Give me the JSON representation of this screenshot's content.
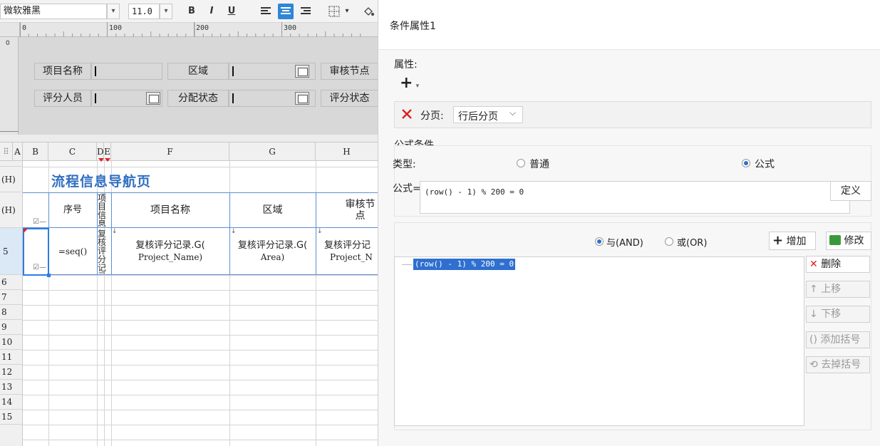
{
  "toolbar": {
    "font_name": "微软雅黑",
    "font_size": "11.0",
    "bold": "B",
    "italic": "I",
    "underline": "U"
  },
  "ruler": {
    "marks": [
      "0",
      "100",
      "200",
      "300"
    ]
  },
  "params": {
    "row1": [
      {
        "label": "项目名称"
      },
      {
        "label": "区域"
      },
      {
        "label": "审核节点"
      }
    ],
    "row2": [
      {
        "label": "评分人员"
      },
      {
        "label": "分配状态"
      },
      {
        "label": "评分状态"
      }
    ]
  },
  "grid": {
    "columns": [
      "A",
      "B",
      "C",
      "D",
      "E",
      "F",
      "G",
      "H"
    ],
    "rows": [
      "(H)",
      "(H)",
      "5",
      "6",
      "7",
      "8",
      "9",
      "10",
      "11",
      "12",
      "13",
      "14",
      "15"
    ],
    "title": "流程信息导航页",
    "headers": {
      "seq": "序号",
      "narrow1": "项目信息",
      "project_name": "项目名称",
      "area": "区域",
      "audit": "审核节点"
    },
    "data": {
      "seq": "=seq()",
      "narrow": "复核评分记录",
      "project_name_l1": "复核评分记录.G(",
      "project_name_l2": "Project_Name)",
      "area_l1": "复核评分记录.G(",
      "area_l2": "Area)",
      "audit_l1": "复核评分记",
      "audit_l2": "Project_N"
    }
  },
  "dialog": {
    "title": "条件属性1",
    "attr_section": "属性:",
    "add_symbol": "+",
    "page_label": "分页:",
    "page_value": "行后分页",
    "formula_section": "公式条件",
    "type_label": "类型:",
    "type_normal": "普通",
    "type_formula": "公式",
    "formula_label": "公式=",
    "formula_value": "(row() - 1) % 200 = 0",
    "define_btn": "定义",
    "and_label": "与(AND)",
    "or_label": "或(OR)",
    "add_btn": "增加",
    "modify_btn": "修改",
    "tree_item": "(row() - 1) % 200 = 0",
    "delete_btn": "删除",
    "up_btn": "上移",
    "down_btn": "下移",
    "add_paren_btn": "添加括号",
    "remove_paren_btn": "去掉括号"
  }
}
